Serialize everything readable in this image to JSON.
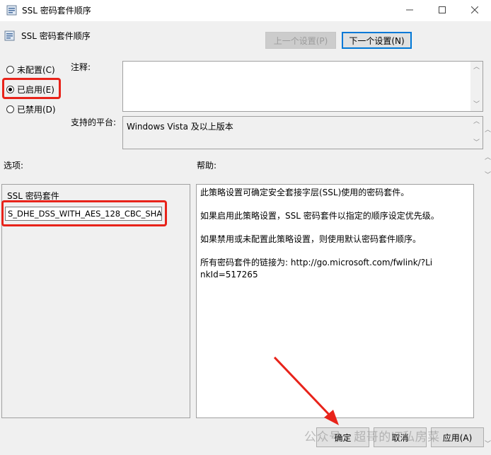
{
  "window": {
    "title": "SSL 密码套件顺序"
  },
  "header": {
    "title": "SSL 密码套件顺序",
    "prev_label": "上一个设置(P)",
    "next_label": "下一个设置(N)"
  },
  "radios": [
    {
      "label": "未配置(C)",
      "checked": false
    },
    {
      "label": "已启用(E)",
      "checked": true
    },
    {
      "label": "已禁用(D)",
      "checked": false
    }
  ],
  "comment": {
    "label": "注释:",
    "value": ""
  },
  "platform": {
    "label": "支持的平台:",
    "value": "Windows Vista 及以上版本"
  },
  "options": {
    "label": "选项:",
    "field_label": "SSL 密码套件",
    "field_value": "S_DHE_DSS_WITH_AES_128_CBC_SHA"
  },
  "help": {
    "label": "帮助:",
    "paragraphs": [
      "此策略设置可确定安全套接字层(SSL)使用的密码套件。",
      "如果启用此策略设置，SSL 密码套件以指定的顺序设定优先级。",
      "如果禁用或未配置此策略设置，则使用默认密码套件顺序。",
      "所有密码套件的链接为: http://go.microsoft.com/fwlink/?LinkId=517265"
    ]
  },
  "footer": {
    "ok_label": "确定",
    "cancel_label": "取消",
    "apply_label": "应用(A)"
  },
  "watermark": "公众号 · 超哥的IT私房菜",
  "colors": {
    "highlight": "#e8231a",
    "accent": "#0078d7"
  }
}
